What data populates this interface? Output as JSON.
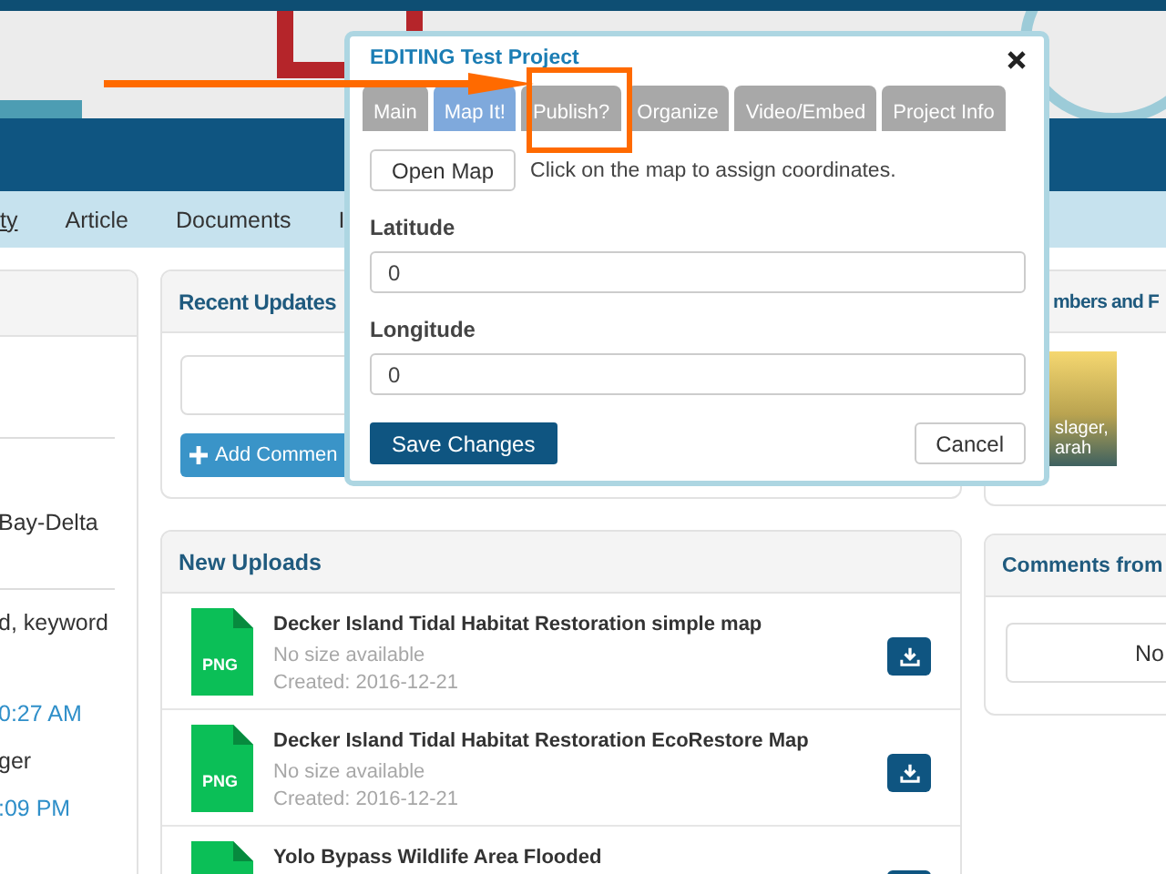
{
  "nav": {
    "links": [
      {
        "label": "ty",
        "selected": true
      },
      {
        "label": "Article",
        "selected": false
      },
      {
        "label": "Documents",
        "selected": false
      },
      {
        "label": "I",
        "selected": false
      }
    ]
  },
  "left_panel": {
    "lines": [
      {
        "text": "Bay-Delta",
        "kind": "text"
      },
      {
        "text": "d, keyword",
        "kind": "text"
      },
      {
        "text": "0:27 AM",
        "kind": "link"
      },
      {
        "text": "ger",
        "kind": "text"
      },
      {
        "text": ":09 PM",
        "kind": "link"
      }
    ]
  },
  "recent_updates": {
    "title": "Recent Updates",
    "add_comment_button": "Add Commen"
  },
  "new_uploads": {
    "title": "New Uploads",
    "files": [
      {
        "type": "PNG",
        "name": "Decker Island Tidal Habitat Restoration simple map",
        "size": "No size available",
        "created": "Created: 2016-12-21"
      },
      {
        "type": "PNG",
        "name": "Decker Island Tidal Habitat Restoration EcoRestore Map",
        "size": "No size available",
        "created": "Created: 2016-12-21"
      },
      {
        "name": "Yolo Bypass Wildlife Area Flooded"
      }
    ]
  },
  "members": {
    "title": "mbers and F",
    "tiles": [
      {
        "caption": [
          "slager,",
          "arah"
        ]
      }
    ]
  },
  "comments": {
    "title": "Comments from",
    "message": "No"
  },
  "dialog": {
    "title": "EDITING Test Project",
    "tabs": [
      {
        "label": "Main",
        "selected": false
      },
      {
        "label": "Map It!",
        "selected": true
      },
      {
        "label": "Publish?",
        "selected": false
      },
      {
        "label": "Organize",
        "selected": false
      },
      {
        "label": "Video/Embed",
        "selected": false
      },
      {
        "label": "Project Info",
        "selected": false
      }
    ],
    "open_map_button": "Open Map",
    "hint": "Click on the map to assign coordinates.",
    "fields": [
      {
        "label": "Latitude",
        "value": "0"
      },
      {
        "label": "Longitude",
        "value": "0"
      }
    ],
    "save_button": "Save Changes",
    "cancel_button": "Cancel"
  }
}
